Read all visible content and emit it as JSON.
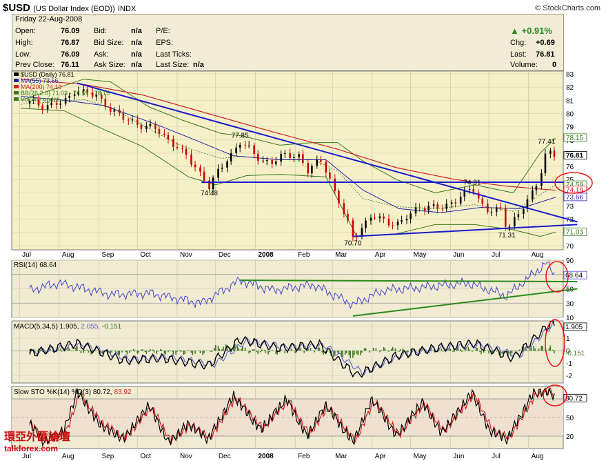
{
  "header": {
    "symbol": "$USD",
    "name": "(US Dollar Index (EOD))",
    "exchange": "INDX",
    "source": "© StockCharts.com"
  },
  "quote": {
    "date": "Friday  22-Aug-2008",
    "open_label": "Open:",
    "open": "76.09",
    "high_label": "High:",
    "high": "76.87",
    "low_label": "Low:",
    "low": "76.09",
    "prev_label": "Prev Close:",
    "prev": "76.11",
    "bid_label": "Bid:",
    "bid": "n/a",
    "bidsize_label": "Bid Size:",
    "bidsize": "n/a",
    "ask_label": "Ask:",
    "ask": "n/a",
    "asksize_label": "Ask Size:",
    "asksize": "n/a",
    "pe_label": "P/E:",
    "eps_label": "EPS:",
    "lastticks_label": "Last Ticks:",
    "lastsize_label": "Last Size:",
    "lastsize": "n/a",
    "pct_change": "0.91%",
    "chg_label": "Chg:",
    "chg": "+0.69",
    "last_label": "Last:",
    "last": "76.81",
    "volume_label": "Volume:",
    "volume": "0"
  },
  "colors": {
    "price_bg": "#f5f0c8",
    "panel_bg": "#f0ebd2",
    "up": "#000000",
    "down": "#cc0000",
    "ma55": "#2222aa",
    "ma200": "#cc2222",
    "bb": "#3a7a1a",
    "trend_blue": "#1a1acc",
    "trend_green": "#2a8a1a",
    "rsi": "#4444cc",
    "macd": "#000000",
    "signal": "#6666cc",
    "k_line": "#000000",
    "d_line": "#cc2222",
    "circle": "#ee1111"
  },
  "chart_data": [
    {
      "type": "candlestick",
      "title": "$USD (Daily) 76.81",
      "ylim": [
        70,
        83
      ],
      "y_ticks": [
        70,
        71,
        72,
        73,
        74,
        75,
        76,
        77,
        78,
        79,
        80,
        81,
        82,
        83
      ],
      "x_labels": [
        "Jul",
        "Aug",
        "Sep",
        "Oct",
        "Nov",
        "Dec",
        "2008",
        "Feb",
        "Mar",
        "Apr",
        "May",
        "Jun",
        "Jul",
        "Aug"
      ],
      "legend": [
        {
          "label": "$USD (Daily) 76.81"
        },
        {
          "label": "MA(55) 73.66"
        },
        {
          "label": "MA(200) 74.19"
        },
        {
          "label": "BB(26,2.0) 71.03 - 74.59 - 78.15"
        },
        {
          "label": "Volume undef"
        }
      ],
      "close_points": [
        [
          "2007-07-02",
          81.0
        ],
        [
          "2007-07-20",
          80.6
        ],
        [
          "2007-08-05",
          80.8
        ],
        [
          "2007-08-14",
          81.9
        ],
        [
          "2007-08-31",
          81.2
        ],
        [
          "2007-09-20",
          79.6
        ],
        [
          "2007-10-15",
          78.8
        ],
        [
          "2007-10-31",
          77.6
        ],
        [
          "2007-11-20",
          75.4
        ],
        [
          "2007-11-26",
          74.48
        ],
        [
          "2007-12-06",
          76.0
        ],
        [
          "2007-12-20",
          77.85
        ],
        [
          "2008-01-05",
          76.5
        ],
        [
          "2008-01-15",
          76.3
        ],
        [
          "2008-01-25",
          76.9
        ],
        [
          "2008-02-05",
          76.8
        ],
        [
          "2008-02-10",
          75.5
        ],
        [
          "2008-02-22",
          76.6
        ],
        [
          "2008-03-01",
          74.5
        ],
        [
          "2008-03-17",
          70.7
        ],
        [
          "2008-04-01",
          72.2
        ],
        [
          "2008-04-22",
          71.6
        ],
        [
          "2008-05-08",
          73.0
        ],
        [
          "2008-05-25",
          72.8
        ],
        [
          "2008-06-18",
          74.31
        ],
        [
          "2008-06-28",
          72.8
        ],
        [
          "2008-07-10",
          72.6
        ],
        [
          "2008-07-15",
          71.31
        ],
        [
          "2008-07-25",
          72.6
        ],
        [
          "2008-08-05",
          74.0
        ],
        [
          "2008-08-12",
          76.0
        ],
        [
          "2008-08-15",
          77.41
        ],
        [
          "2008-08-22",
          76.81
        ]
      ],
      "ma55_points": [
        [
          "2007-07-02",
          81.3
        ],
        [
          "2007-08-05",
          81.0
        ],
        [
          "2007-09-05",
          80.6
        ],
        [
          "2007-10-15",
          79.2
        ],
        [
          "2007-11-15",
          78.0
        ],
        [
          "2007-12-15",
          76.8
        ],
        [
          "2008-01-20",
          76.5
        ],
        [
          "2008-02-25",
          76.5
        ],
        [
          "2008-03-25",
          74.2
        ],
        [
          "2008-04-22",
          72.8
        ],
        [
          "2008-05-25",
          72.5
        ],
        [
          "2008-06-25",
          72.9
        ],
        [
          "2008-07-25",
          72.8
        ],
        [
          "2008-08-22",
          73.66
        ]
      ],
      "ma200_points": [
        [
          "2007-07-02",
          82.6
        ],
        [
          "2007-08-20",
          82.2
        ],
        [
          "2007-10-05",
          81.4
        ],
        [
          "2007-11-25",
          80.0
        ],
        [
          "2008-01-15",
          78.6
        ],
        [
          "2008-03-05",
          77.3
        ],
        [
          "2008-04-20",
          75.9
        ],
        [
          "2008-06-05",
          75.0
        ],
        [
          "2008-07-15",
          74.5
        ],
        [
          "2008-08-22",
          74.19
        ]
      ],
      "bb_upper_points": [
        [
          "2007-07-02",
          81.0
        ],
        [
          "2007-08-20",
          82.6
        ],
        [
          "2007-09-10",
          82.4
        ],
        [
          "2007-10-10",
          80.5
        ],
        [
          "2007-11-05",
          79.5
        ],
        [
          "2007-12-05",
          78.5
        ],
        [
          "2007-12-22",
          78.3
        ],
        [
          "2008-01-20",
          77.6
        ],
        [
          "2008-02-15",
          77.8
        ],
        [
          "2008-03-05",
          77.8
        ],
        [
          "2008-03-25",
          76.4
        ],
        [
          "2008-04-20",
          75.0
        ],
        [
          "2008-05-20",
          74.0
        ],
        [
          "2008-06-20",
          74.6
        ],
        [
          "2008-07-20",
          74.0
        ],
        [
          "2008-08-10",
          77.0
        ],
        [
          "2008-08-22",
          78.15
        ]
      ],
      "bb_lower_points": [
        [
          "2007-07-02",
          80.4
        ],
        [
          "2007-08-05",
          80.2
        ],
        [
          "2007-08-31",
          79.0
        ],
        [
          "2007-10-05",
          77.5
        ],
        [
          "2007-11-10",
          75.2
        ],
        [
          "2007-12-01",
          74.6
        ],
        [
          "2007-12-25",
          75.3
        ],
        [
          "2008-01-20",
          75.4
        ],
        [
          "2008-02-25",
          75.2
        ],
        [
          "2008-03-20",
          70.7
        ],
        [
          "2008-04-20",
          70.9
        ],
        [
          "2008-05-20",
          71.6
        ],
        [
          "2008-06-20",
          71.6
        ],
        [
          "2008-07-20",
          71.2
        ],
        [
          "2008-08-10",
          70.7
        ],
        [
          "2008-08-22",
          71.03
        ]
      ],
      "annotations": [
        {
          "date": "2007-11-26",
          "value": 74.48,
          "label": "74.48"
        },
        {
          "date": "2007-12-20",
          "value": 77.85,
          "label": "77.85"
        },
        {
          "date": "2008-03-17",
          "value": 70.7,
          "label": "70.70"
        },
        {
          "date": "2008-06-18",
          "value": 74.31,
          "label": "74.31"
        },
        {
          "date": "2008-07-15",
          "value": 71.31,
          "label": "71.31"
        },
        {
          "date": "2008-08-15",
          "value": 77.41,
          "label": "77.41"
        }
      ],
      "right_labels": [
        "78.15",
        "76.81",
        "74.59",
        "74.19",
        "73.66",
        "71.03"
      ],
      "trendlines": [
        {
          "from": [
            "2007-08-15",
            82.3
          ],
          "to": [
            "2008-09-08",
            71.8
          ],
          "color": "blue"
        },
        {
          "from": [
            "2007-11-20",
            74.8
          ],
          "to": [
            "2008-09-08",
            74.8
          ],
          "color": "blue"
        },
        {
          "from": [
            "2008-03-17",
            70.7
          ],
          "to": [
            "2008-09-08",
            71.6
          ],
          "color": "blue"
        }
      ]
    },
    {
      "type": "line",
      "title": "RSI(14) 68.64",
      "ylim": [
        10,
        90
      ],
      "y_ticks": [
        10,
        30,
        50,
        70,
        90
      ],
      "series": [
        {
          "name": "RSI(14)",
          "values": [
            [
              "2007-07-02",
              45
            ],
            [
              "2007-08-01",
              58
            ],
            [
              "2007-09-10",
              42
            ],
            [
              "2007-10-10",
              44
            ],
            [
              "2007-11-20",
              30
            ],
            [
              "2007-12-20",
              62
            ],
            [
              "2008-01-15",
              48
            ],
            [
              "2008-02-15",
              56
            ],
            [
              "2008-03-17",
              28
            ],
            [
              "2008-04-10",
              48
            ],
            [
              "2008-05-10",
              52
            ],
            [
              "2008-06-15",
              58
            ],
            [
              "2008-07-15",
              40
            ],
            [
              "2008-08-15",
              86
            ],
            [
              "2008-08-22",
              68.64
            ]
          ]
        }
      ],
      "right_labels": [
        "68.64"
      ],
      "trendlines": [
        {
          "from": [
            "2007-12-20",
            62
          ],
          "to": [
            "2008-09-08",
            60
          ],
          "color": "green"
        },
        {
          "from": [
            "2008-03-17",
            12
          ],
          "to": [
            "2008-09-08",
            50
          ],
          "color": "green"
        }
      ]
    },
    {
      "type": "line",
      "title": "MACD(5,34,5) 1.905, 2.055, -0.151",
      "ylim": [
        -2.6,
        2.4
      ],
      "y_ticks": [
        -2,
        -1,
        0,
        1,
        2
      ],
      "series": [
        {
          "name": "MACD(5,34,5) 1.905",
          "values": [
            [
              "2007-07-02",
              -0.4
            ],
            [
              "2007-08-15",
              0.6
            ],
            [
              "2007-09-20",
              -0.8
            ],
            [
              "2007-10-20",
              -0.6
            ],
            [
              "2007-11-25",
              -1.2
            ],
            [
              "2007-12-20",
              0.9
            ],
            [
              "2008-01-20",
              0.2
            ],
            [
              "2008-02-20",
              0.5
            ],
            [
              "2008-03-20",
              -2.0
            ],
            [
              "2008-04-20",
              -0.4
            ],
            [
              "2008-05-20",
              0.2
            ],
            [
              "2008-06-20",
              0.6
            ],
            [
              "2008-07-20",
              -0.6
            ],
            [
              "2008-08-18",
              2.2
            ],
            [
              "2008-08-22",
              1.905
            ]
          ]
        },
        {
          "name": "2.055",
          "values": [
            [
              "2007-07-02",
              -0.3
            ],
            [
              "2007-08-20",
              0.5
            ],
            [
              "2007-09-25",
              -0.7
            ],
            [
              "2007-10-25",
              -0.5
            ],
            [
              "2007-11-30",
              -1.1
            ],
            [
              "2007-12-25",
              0.8
            ],
            [
              "2008-01-25",
              0.3
            ],
            [
              "2008-02-25",
              0.4
            ],
            [
              "2008-03-25",
              -1.8
            ],
            [
              "2008-04-25",
              -0.3
            ],
            [
              "2008-05-25",
              0.2
            ],
            [
              "2008-06-25",
              0.5
            ],
            [
              "2008-07-25",
              -0.4
            ],
            [
              "2008-08-20",
              2.1
            ],
            [
              "2008-08-22",
              2.055
            ]
          ]
        },
        {
          "name": "-0.151",
          "values": []
        }
      ],
      "right_labels": [
        "1.905",
        "-0.151"
      ]
    },
    {
      "type": "line",
      "title": "Slow STO %K(14) %D(3) 80.72, 83.92",
      "ylim": [
        0,
        100
      ],
      "y_ticks": [
        20,
        50,
        80
      ],
      "series": [
        {
          "name": "%K(14)",
          "values": [
            [
              "2007-07-02",
              60
            ],
            [
              "2007-07-20",
              10
            ],
            [
              "2007-08-05",
              30
            ],
            [
              "2007-08-15",
              92
            ],
            [
              "2007-09-01",
              40
            ],
            [
              "2007-09-20",
              15
            ],
            [
              "2007-10-10",
              70
            ],
            [
              "2007-10-25",
              10
            ],
            [
              "2007-11-10",
              40
            ],
            [
              "2007-11-25",
              15
            ],
            [
              "2007-12-15",
              85
            ],
            [
              "2008-01-05",
              30
            ],
            [
              "2008-01-25",
              80
            ],
            [
              "2008-02-10",
              20
            ],
            [
              "2008-02-25",
              70
            ],
            [
              "2008-03-17",
              10
            ],
            [
              "2008-04-01",
              80
            ],
            [
              "2008-04-20",
              20
            ],
            [
              "2008-05-10",
              75
            ],
            [
              "2008-05-25",
              25
            ],
            [
              "2008-06-18",
              90
            ],
            [
              "2008-07-01",
              30
            ],
            [
              "2008-07-15",
              15
            ],
            [
              "2008-08-05",
              90
            ],
            [
              "2008-08-18",
              92
            ],
            [
              "2008-08-22",
              80.72
            ]
          ]
        },
        {
          "name": "%D(3)",
          "values": [
            [
              "2007-07-02",
              58
            ],
            [
              "2007-07-22",
              12
            ],
            [
              "2007-08-07",
              28
            ],
            [
              "2007-08-17",
              90
            ],
            [
              "2007-09-03",
              42
            ],
            [
              "2007-09-22",
              17
            ],
            [
              "2007-10-12",
              68
            ],
            [
              "2007-10-27",
              12
            ],
            [
              "2007-11-12",
              38
            ],
            [
              "2007-11-27",
              17
            ],
            [
              "2007-12-17",
              83
            ],
            [
              "2008-01-07",
              32
            ],
            [
              "2008-01-27",
              78
            ],
            [
              "2008-02-12",
              22
            ],
            [
              "2008-02-27",
              68
            ],
            [
              "2008-03-19",
              12
            ],
            [
              "2008-04-03",
              78
            ],
            [
              "2008-04-22",
              22
            ],
            [
              "2008-05-12",
              73
            ],
            [
              "2008-05-27",
              27
            ],
            [
              "2008-06-20",
              88
            ],
            [
              "2008-07-03",
              32
            ],
            [
              "2008-07-17",
              17
            ],
            [
              "2008-08-07",
              88
            ],
            [
              "2008-08-19",
              93
            ],
            [
              "2008-08-22",
              83.92
            ]
          ]
        }
      ],
      "right_labels": [
        "80.72"
      ]
    }
  ],
  "watermark": {
    "chars": "環亞外匯論壇",
    "url": "talkforex.com"
  }
}
